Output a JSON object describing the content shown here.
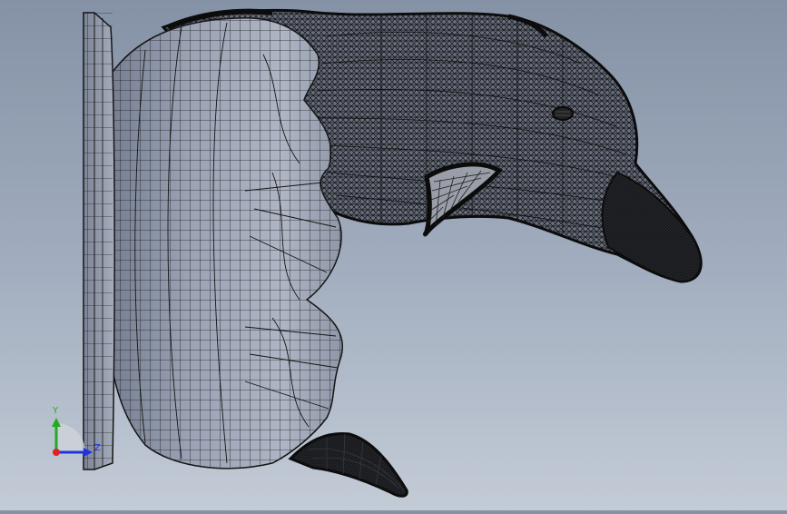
{
  "viewport": {
    "model": "duck-wall-mount",
    "render_mode": "wireframe-shaded",
    "colors": {
      "background_top": "#8592a6",
      "background_bottom": "#c3cbd6",
      "shaded_surface": "#8c94a6",
      "surface_light": "#aab1c0",
      "wire": "#141414",
      "mesh_dense": "#1c1c1c"
    }
  },
  "triad": {
    "y_label": "Y",
    "z_label": "Z",
    "y_color": "#22aa22",
    "z_color": "#2233dd",
    "x_color": "#dd2222"
  }
}
